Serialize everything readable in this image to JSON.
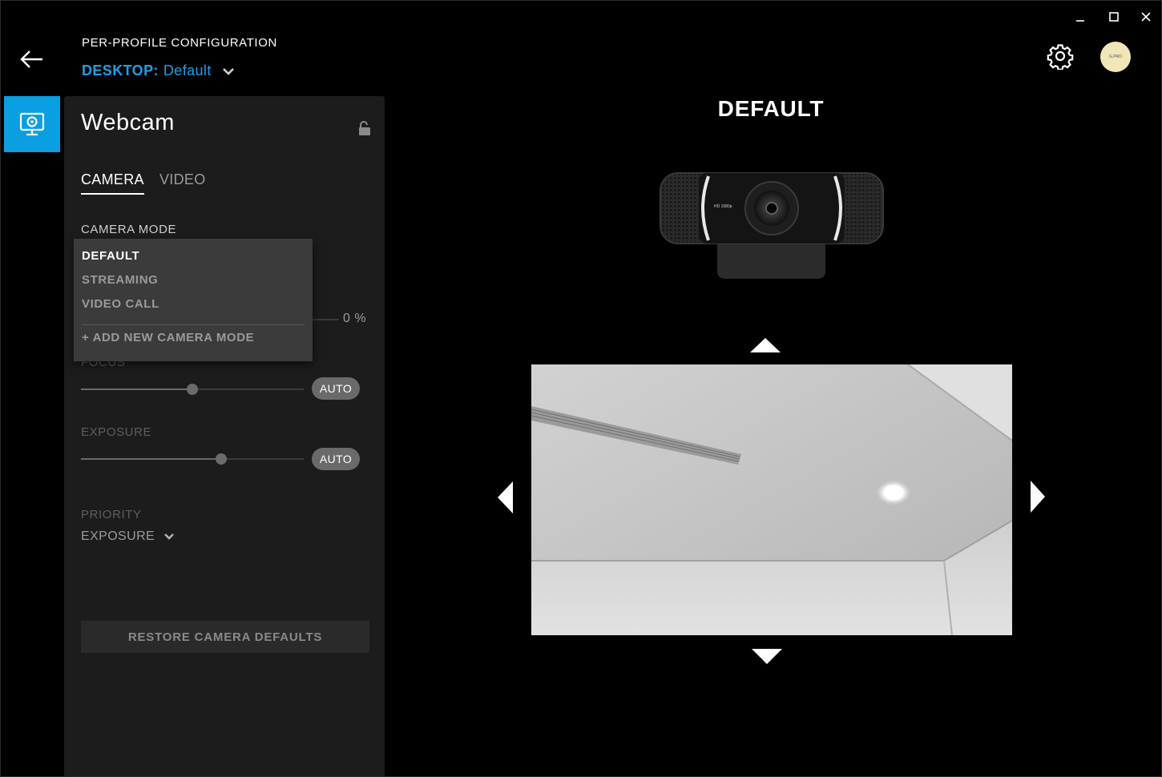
{
  "header": {
    "config_label": "PER-PROFILE CONFIGURATION",
    "profile_prefix": "DESKTOP:",
    "profile_name": "Default"
  },
  "avatar_text": "G.PRO",
  "panel": {
    "title": "Webcam",
    "tabs": [
      {
        "label": "CAMERA",
        "active": true
      },
      {
        "label": "VIDEO",
        "active": false
      }
    ],
    "camera_mode_label": "CAMERA MODE",
    "zoom_value": "0 %",
    "focus": {
      "label": "FOCUS",
      "auto_label": "AUTO",
      "level": 0.5
    },
    "exposure": {
      "label": "EXPOSURE",
      "auto_label": "AUTO",
      "level": 0.63
    },
    "priority": {
      "label": "PRIORITY",
      "value": "EXPOSURE"
    },
    "restore_label": "RESTORE CAMERA DEFAULTS"
  },
  "dropdown": {
    "items": [
      "DEFAULT",
      "STREAMING",
      "VIDEO CALL"
    ],
    "selected": "DEFAULT",
    "add_label": "+ ADD NEW CAMERA MODE"
  },
  "main": {
    "mode_title": "DEFAULT",
    "camera_badge": "HD 1080p"
  },
  "colors": {
    "accent": "#1ea0e6",
    "device_tab": "#0a9fe0",
    "panel_bg": "#1c1c1d",
    "dropdown_bg": "#3b3b3c"
  }
}
